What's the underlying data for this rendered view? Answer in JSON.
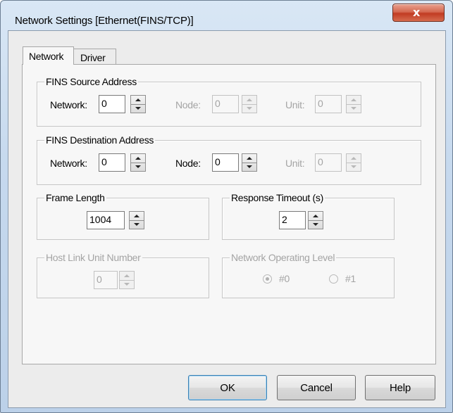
{
  "window": {
    "title": "Network Settings [Ethernet(FINS/TCP)]",
    "close_glyph": "x"
  },
  "tabs": [
    {
      "label": "Network",
      "selected": true
    },
    {
      "label": "Driver",
      "selected": false
    }
  ],
  "fins_source": {
    "title": "FINS Source Address",
    "network_label": "Network:",
    "network_value": "0",
    "node_label": "Node:",
    "node_value": "0",
    "unit_label": "Unit:",
    "unit_value": "0"
  },
  "fins_destination": {
    "title": "FINS Destination Address",
    "network_label": "Network:",
    "network_value": "0",
    "node_label": "Node:",
    "node_value": "0",
    "unit_label": "Unit:",
    "unit_value": "0"
  },
  "frame_length": {
    "title": "Frame Length",
    "value": "1004"
  },
  "response_timeout": {
    "title": "Response Timeout (s)",
    "value": "2"
  },
  "host_link": {
    "title": "Host Link Unit Number",
    "value": "0"
  },
  "network_level": {
    "title": "Network Operating Level",
    "option0": "#0",
    "option1": "#1",
    "selected": "#0"
  },
  "buttons": {
    "ok": "OK",
    "cancel": "Cancel",
    "help": "Help"
  },
  "colors": {
    "titlebar": "#c6d9ee",
    "close_button": "#c13b22",
    "dialog_face": "#ececec",
    "disabled_text": "#a4a4a4"
  }
}
